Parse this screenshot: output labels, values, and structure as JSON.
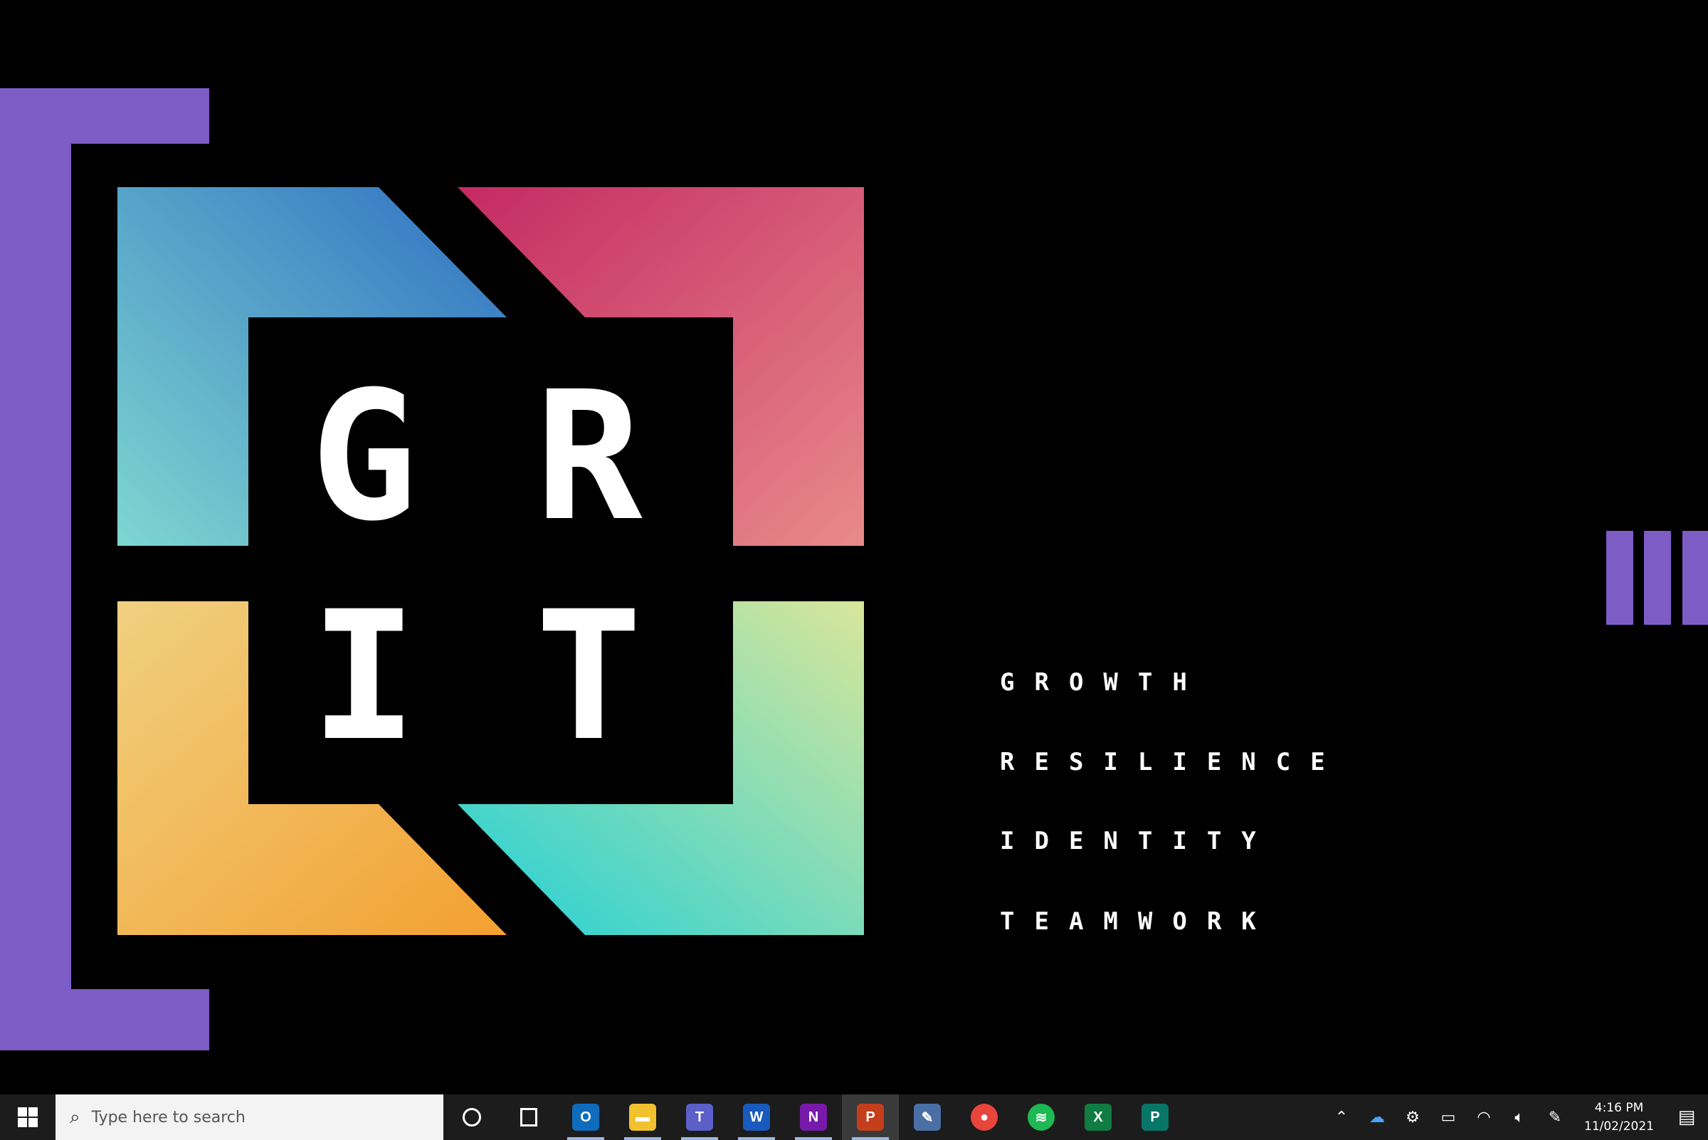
{
  "slide": {
    "logo_letters": [
      "G",
      "R",
      "I",
      "T"
    ],
    "words": [
      "GROWTH",
      "RESILIENCE",
      "IDENTITY",
      "TEAMWORK"
    ],
    "colors": {
      "purple": "#7d5cc6",
      "blue_start": "#2f6fc2",
      "blue_end": "#7fd6d0",
      "pink_start": "#c42a63",
      "pink_end": "#e88a8a",
      "yellow_start": "#f0d080",
      "yellow_end": "#f3a030",
      "teal_start": "#d8e69a",
      "teal_end": "#20d0d8"
    }
  },
  "taskbar": {
    "search_placeholder": "Type here to search",
    "pinned_apps": [
      {
        "icon": "outlook-icon",
        "glyph": "O",
        "color": "#0f6cbd"
      },
      {
        "icon": "file-explorer-icon",
        "glyph": "▬",
        "color": "#f2c12e"
      },
      {
        "icon": "teams-icon",
        "glyph": "T",
        "color": "#5b5fc7"
      },
      {
        "icon": "word-icon",
        "glyph": "W",
        "color": "#185abd"
      },
      {
        "icon": "onenote-icon",
        "glyph": "N",
        "color": "#7719aa"
      },
      {
        "icon": "powerpoint-icon",
        "glyph": "P",
        "color": "#c43e1c"
      },
      {
        "icon": "paint-icon",
        "glyph": "✎",
        "color": "#4a6fa5"
      },
      {
        "icon": "chrome-icon",
        "glyph": "●",
        "color": "#e8453c"
      },
      {
        "icon": "spotify-icon",
        "glyph": "≋",
        "color": "#1db954"
      },
      {
        "icon": "excel-icon",
        "glyph": "X",
        "color": "#107c41"
      },
      {
        "icon": "publisher-icon",
        "glyph": "P",
        "color": "#077568"
      }
    ],
    "active_app_index": 5,
    "clock_time": "4:16 PM",
    "clock_date": "11/02/2021"
  }
}
